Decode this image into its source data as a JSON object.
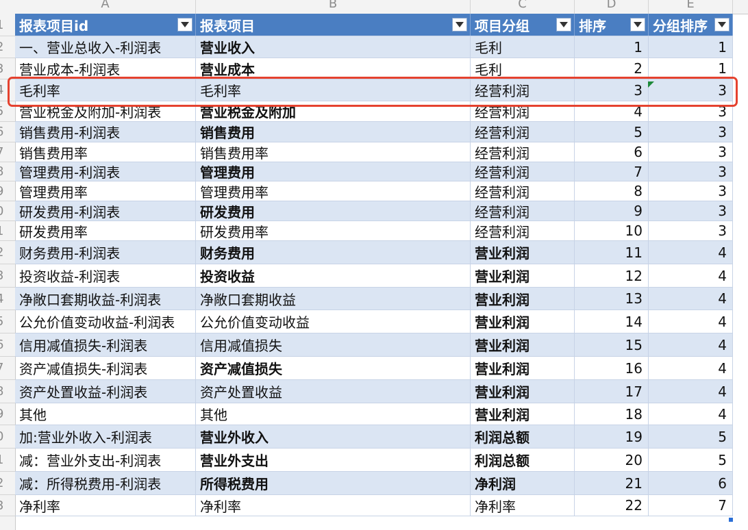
{
  "columns": [
    "A",
    "B",
    "C",
    "D",
    "E"
  ],
  "headers": [
    "报表项目id",
    "报表项目",
    "项目分组",
    "排序",
    "分组排序"
  ],
  "row_numbers": [
    "1",
    "2",
    "3",
    "4",
    "5",
    "6",
    "7",
    "8",
    "9",
    "0",
    "1",
    "2",
    "3",
    "4",
    "5",
    "6",
    "7",
    "8",
    "9",
    "0",
    "1",
    "2",
    "3"
  ],
  "rows": [
    {
      "a": "一、营业总收入-利润表",
      "b": "营业收入",
      "c": "毛利",
      "d": "1",
      "e": "1",
      "bold_b": true,
      "bold_c": false
    },
    {
      "a": "营业成本-利润表",
      "b": "营业成本",
      "c": "毛利",
      "d": "2",
      "e": "1",
      "bold_b": true,
      "bold_c": false
    },
    {
      "a": "毛利率",
      "b": "毛利率",
      "c": "经营利润",
      "d": "3",
      "e": "3",
      "bold_b": false,
      "bold_c": false
    },
    {
      "a": "营业税金及附加-利润表",
      "b": "营业税金及附加",
      "c": "经营利润",
      "d": "4",
      "e": "3",
      "bold_b": true,
      "bold_c": false
    },
    {
      "a": "销售费用-利润表",
      "b": "销售费用",
      "c": "经营利润",
      "d": "5",
      "e": "3",
      "bold_b": true,
      "bold_c": false
    },
    {
      "a": "销售费用率",
      "b": "销售费用率",
      "c": "经营利润",
      "d": "6",
      "e": "3",
      "bold_b": false,
      "bold_c": false
    },
    {
      "a": "管理费用-利润表",
      "b": "管理费用",
      "c": "经营利润",
      "d": "7",
      "e": "3",
      "bold_b": true,
      "bold_c": false
    },
    {
      "a": "管理费用率",
      "b": "管理费用率",
      "c": "经营利润",
      "d": "8",
      "e": "3",
      "bold_b": false,
      "bold_c": false
    },
    {
      "a": "研发费用-利润表",
      "b": "研发费用",
      "c": "经营利润",
      "d": "9",
      "e": "3",
      "bold_b": true,
      "bold_c": false
    },
    {
      "a": "研发费用率",
      "b": "研发费用率",
      "c": "经营利润",
      "d": "10",
      "e": "3",
      "bold_b": false,
      "bold_c": false
    },
    {
      "a": "财务费用-利润表",
      "b": "财务费用",
      "c": "营业利润",
      "d": "11",
      "e": "4",
      "bold_b": true,
      "bold_c": true
    },
    {
      "a": "投资收益-利润表",
      "b": "投资收益",
      "c": "营业利润",
      "d": "12",
      "e": "4",
      "bold_b": true,
      "bold_c": true
    },
    {
      "a": "净敞口套期收益-利润表",
      "b": "净敞口套期收益",
      "c": "营业利润",
      "d": "13",
      "e": "4",
      "bold_b": false,
      "bold_c": true
    },
    {
      "a": "公允价值变动收益-利润表",
      "b": "公允价值变动收益",
      "c": "营业利润",
      "d": "14",
      "e": "4",
      "bold_b": false,
      "bold_c": true
    },
    {
      "a": "信用减值损失-利润表",
      "b": "信用减值损失",
      "c": "营业利润",
      "d": "15",
      "e": "4",
      "bold_b": false,
      "bold_c": true
    },
    {
      "a": "资产减值损失-利润表",
      "b": "资产减值损失",
      "c": "营业利润",
      "d": "16",
      "e": "4",
      "bold_b": true,
      "bold_c": true
    },
    {
      "a": "资产处置收益-利润表",
      "b": "资产处置收益",
      "c": "营业利润",
      "d": "17",
      "e": "4",
      "bold_b": false,
      "bold_c": true
    },
    {
      "a": "其他",
      "b": "其他",
      "c": "营业利润",
      "d": "18",
      "e": "4",
      "bold_b": false,
      "bold_c": true
    },
    {
      "a": "加:营业外收入-利润表",
      "b": "营业外收入",
      "c": "利润总额",
      "d": "19",
      "e": "5",
      "bold_b": true,
      "bold_c": true
    },
    {
      "a": "减：营业外支出-利润表",
      "b": "营业外支出",
      "c": "利润总额",
      "d": "20",
      "e": "5",
      "bold_b": true,
      "bold_c": true
    },
    {
      "a": "减：所得税费用-利润表",
      "b": "所得税费用",
      "c": "净利润",
      "d": "21",
      "e": "6",
      "bold_b": true,
      "bold_c": true
    },
    {
      "a": "净利率",
      "b": "净利率",
      "c": "净利率",
      "d": "22",
      "e": "7",
      "bold_b": false,
      "bold_c": false
    }
  ],
  "colors": {
    "header_fill": "#4a7ec2",
    "band_fill": "#dbe5f3",
    "highlight_border": "#e5422f"
  }
}
